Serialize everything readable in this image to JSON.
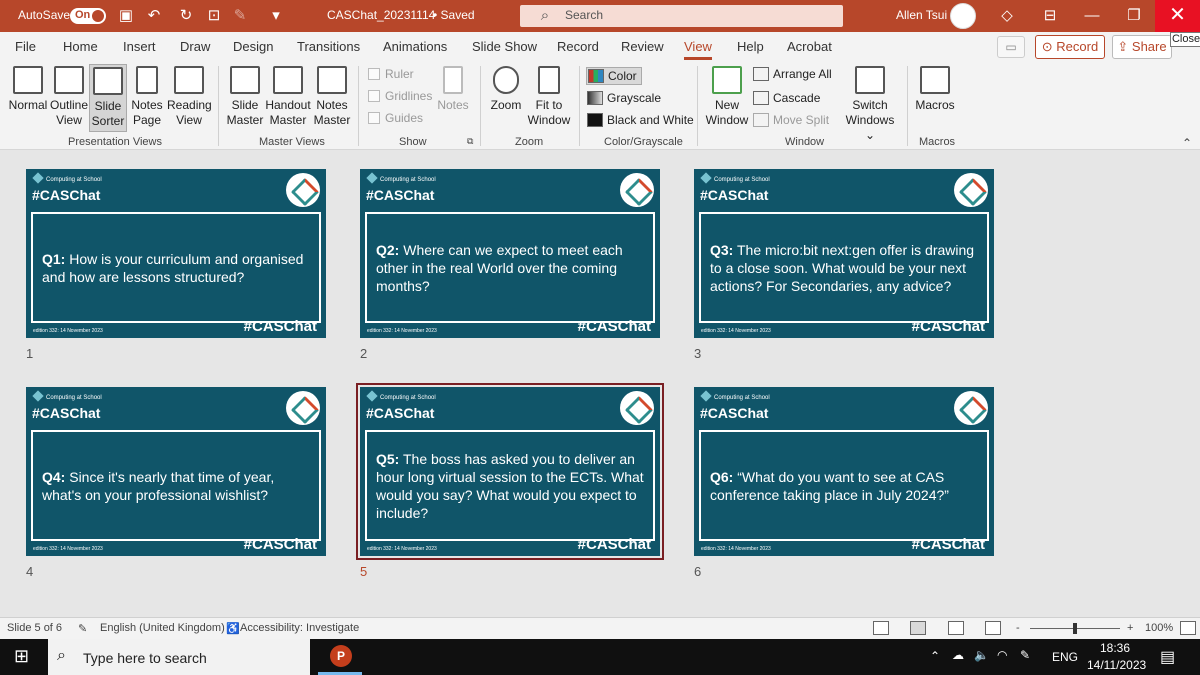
{
  "titlebar": {
    "autosave_label": "AutoSave",
    "autosave_state": "On",
    "document_title": "CASChat_20231114",
    "save_status": "• Saved",
    "search_placeholder": "Search",
    "user_name": "Allen Tsui",
    "close_tooltip": "Close",
    "accent_color": "#b7472a"
  },
  "menu": {
    "tabs": [
      "File",
      "Home",
      "Insert",
      "Draw",
      "Design",
      "Transitions",
      "Animations",
      "Slide Show",
      "Record",
      "Review",
      "View",
      "Help",
      "Acrobat"
    ],
    "active_tab": "View",
    "record_label": "Record",
    "share_label": "Share"
  },
  "ribbon": {
    "presentation_views": {
      "label": "Presentation Views",
      "normal": "Normal",
      "outline_1": "Outline",
      "outline_2": "View",
      "sorter_1": "Slide",
      "sorter_2": "Sorter",
      "notes_page_1": "Notes",
      "notes_page_2": "Page",
      "reading_1": "Reading",
      "reading_2": "View"
    },
    "master_views": {
      "label": "Master Views",
      "slide_1": "Slide",
      "slide_2": "Master",
      "handout_1": "Handout",
      "handout_2": "Master",
      "notes_1": "Notes",
      "notes_2": "Master"
    },
    "show": {
      "label": "Show",
      "ruler": "Ruler",
      "gridlines": "Gridlines",
      "guides": "Guides",
      "notes": "Notes"
    },
    "zoom": {
      "label": "Zoom",
      "zoom": "Zoom",
      "fit_1": "Fit to",
      "fit_2": "Window"
    },
    "color": {
      "label": "Color/Grayscale",
      "color": "Color",
      "grayscale": "Grayscale",
      "bw": "Black and White"
    },
    "window": {
      "label": "Window",
      "new_1": "New",
      "new_2": "Window",
      "arrange": "Arrange All",
      "cascade": "Cascade",
      "move_split": "Move Split",
      "switch_1": "Switch",
      "switch_2": "Windows ⌄"
    },
    "macros": {
      "label": "Macros",
      "macros": "Macros"
    }
  },
  "slides": [
    {
      "num": "1",
      "brand": "Computing at School",
      "header": "#CASChat",
      "q_label": "Q1:",
      "q_text": " How is your curriculum and organised and how are lessons structured?",
      "footer": "edition 332: 14 November 2023",
      "tag": "#CASChat"
    },
    {
      "num": "2",
      "brand": "Computing at School",
      "header": "#CASChat",
      "q_label": "Q2:",
      "q_text": " Where can we expect to meet each other in the real World over the coming months?",
      "footer": "edition 332: 14 November 2023",
      "tag": "#CASChat"
    },
    {
      "num": "3",
      "brand": "Computing at School",
      "header": "#CASChat",
      "q_label": "Q3:",
      "q_text": " The micro:bit next:gen offer is drawing to a close soon. What would be your next actions?  For Secondaries, any advice?",
      "footer": "edition 332: 14 November 2023",
      "tag": "#CASChat"
    },
    {
      "num": "4",
      "brand": "Computing at School",
      "header": "#CASChat",
      "q_label": "Q4:",
      "q_text": " Since it's nearly that time of year, what's on your professional wishlist?",
      "footer": "edition 332: 14 November 2023",
      "tag": "#CASChat"
    },
    {
      "num": "5",
      "brand": "Computing at School",
      "header": "#CASChat",
      "q_label": "Q5:",
      "q_text": " The boss has asked you to deliver an hour long virtual session to the ECTs. What would you say? What would you expect to include?",
      "footer": "edition 332: 14 November 2023",
      "tag": "#CASChat"
    },
    {
      "num": "6",
      "brand": "Computing at School",
      "header": "#CASChat",
      "q_label": "Q6:",
      "q_text": " “What do you want to see at CAS conference taking place in July 2024?”",
      "footer": "edition 332: 14 November 2023",
      "tag": "#CASChat"
    }
  ],
  "slide_bg_color": "#105569",
  "selected_slide": "5",
  "statusbar": {
    "slide_info": "Slide 5 of 6",
    "language": "English (United Kingdom)",
    "accessibility": "Accessibility: Investigate",
    "zoom_level": "100%",
    "zoom_minus": "-",
    "zoom_plus": "+"
  },
  "taskbar": {
    "search_placeholder": "Type here to search",
    "app_icon": "P",
    "language": "ENG",
    "time": "18:36",
    "date": "14/11/2023"
  }
}
